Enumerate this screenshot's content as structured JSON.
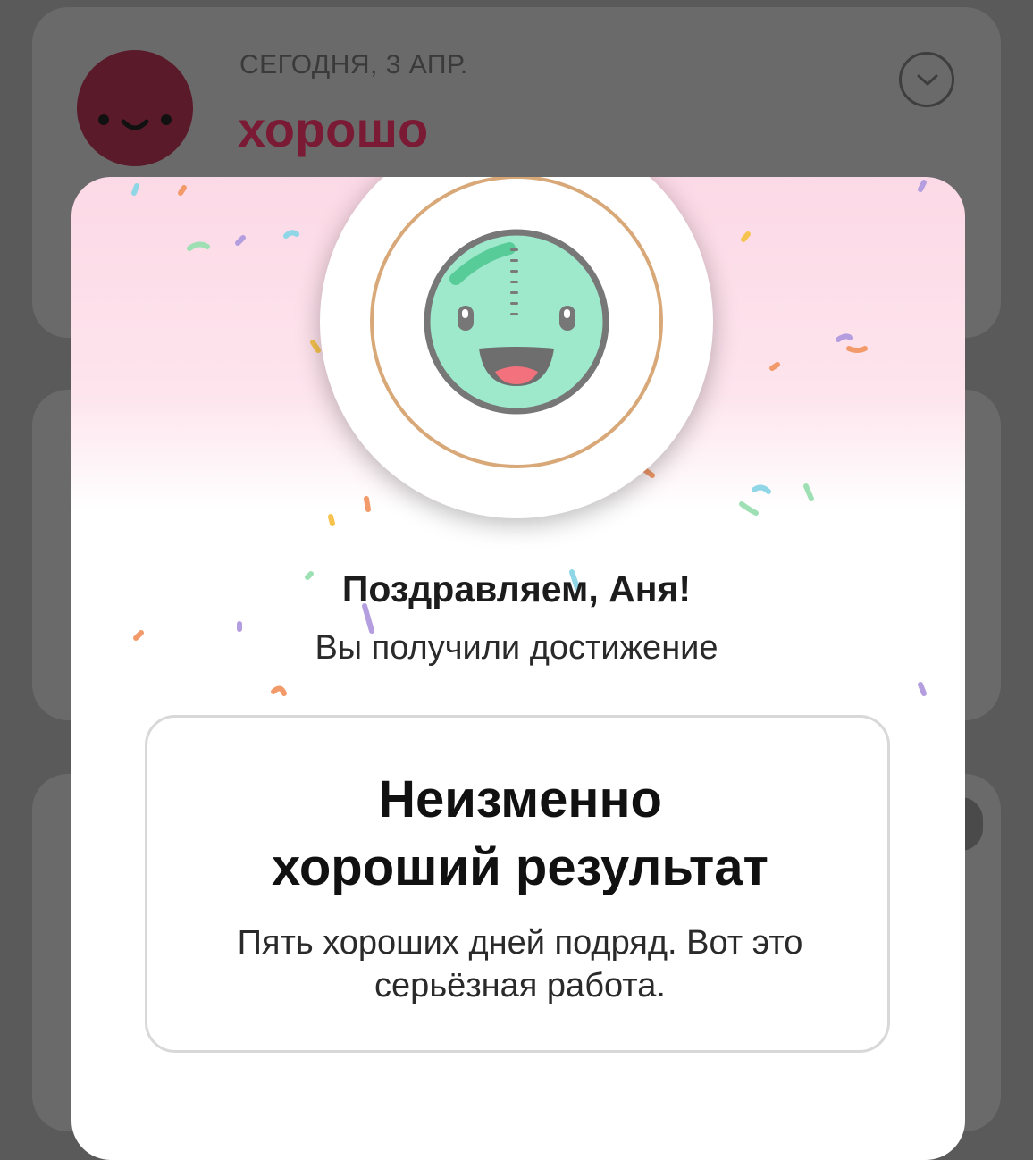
{
  "entry": {
    "date": "СЕГОДНЯ, 3 АПР.",
    "mood": "хорошо"
  },
  "modal": {
    "congrats": "Поздравляем, Аня!",
    "subtitle": "Вы получили достижение",
    "achievement": {
      "title_line1": "Неизменно",
      "title_line2": "хороший результат",
      "desc_line1": "Пять хороших дней подряд. Вот это",
      "desc_line2": "серьёзная работа."
    }
  },
  "icons": {
    "mood_avatar": "smiley-face-icon",
    "expand": "chevron-down-icon",
    "badge": "achievement-smiley-icon"
  },
  "colors": {
    "mood_text": "#7a1a34",
    "badge_face": "#9ee8cc",
    "badge_ring": "#d8a878"
  }
}
